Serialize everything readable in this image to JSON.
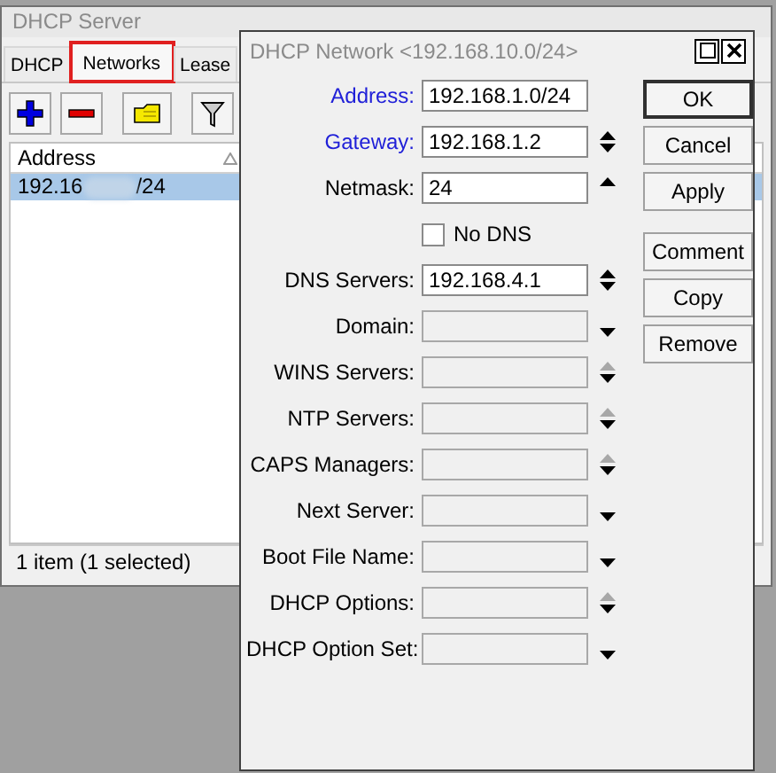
{
  "main_window": {
    "title": "DHCP Server",
    "tabs": [
      {
        "label": "DHCP",
        "selected": false,
        "highlighted": false
      },
      {
        "label": "Networks",
        "selected": true,
        "highlighted": true
      },
      {
        "label": "Lease",
        "selected": false,
        "highlighted": false
      }
    ],
    "toolbar": [
      {
        "kind": "add"
      },
      {
        "kind": "remove"
      },
      {
        "kind": "comment"
      },
      {
        "kind": "filter"
      }
    ],
    "table": {
      "columns": [
        "Address"
      ],
      "rows": [
        {
          "address_start": "192.16",
          "address_end": "/24",
          "redacted": true,
          "selected": true
        }
      ]
    },
    "status_bar": "1 item (1 selected)"
  },
  "dialog": {
    "title": "DHCP Network <192.168.10.0/24>",
    "fields": [
      {
        "kind": "field",
        "label": "Address:",
        "required": true,
        "value": "192.168.1.0/24"
      },
      {
        "kind": "field",
        "label": "Gateway:",
        "required": true,
        "value": "192.168.1.2",
        "arrows": {
          "kind": "updown"
        }
      },
      {
        "kind": "field",
        "label": "Netmask:",
        "required": false,
        "value": "24",
        "arrows": {
          "kind": "up"
        }
      },
      {
        "kind": "checkbox",
        "label": "No DNS",
        "checked": false
      },
      {
        "kind": "field",
        "label": "DNS Servers:",
        "required": false,
        "value": "192.168.4.1",
        "arrows": {
          "kind": "updown"
        }
      },
      {
        "kind": "field",
        "label": "Domain:",
        "required": false,
        "arrows": {
          "kind": "down"
        }
      },
      {
        "kind": "field",
        "label": "WINS Servers:",
        "required": false,
        "arrows": {
          "kind": "dimup"
        }
      },
      {
        "kind": "field",
        "label": "NTP Servers:",
        "required": false,
        "arrows": {
          "kind": "dimup"
        }
      },
      {
        "kind": "field",
        "label": "CAPS Managers:",
        "required": false,
        "arrows": {
          "kind": "dimup"
        }
      },
      {
        "kind": "field",
        "label": "Next Server:",
        "required": false,
        "arrows": {
          "kind": "down"
        }
      },
      {
        "kind": "field",
        "label": "Boot File Name:",
        "required": false,
        "arrows": {
          "kind": "down"
        }
      },
      {
        "kind": "field",
        "label": "DHCP Options:",
        "required": false,
        "arrows": {
          "kind": "dimup"
        }
      },
      {
        "kind": "field",
        "label": "DHCP Option Set:",
        "required": false,
        "arrows": {
          "kind": "down"
        }
      }
    ],
    "buttons": [
      {
        "label": "OK",
        "default": true
      },
      {
        "label": "Cancel",
        "default": false
      },
      {
        "label": "Apply",
        "default": false
      },
      {
        "label": "Comment",
        "default": false
      },
      {
        "label": "Copy",
        "default": false
      },
      {
        "label": "Remove",
        "default": false
      }
    ]
  }
}
